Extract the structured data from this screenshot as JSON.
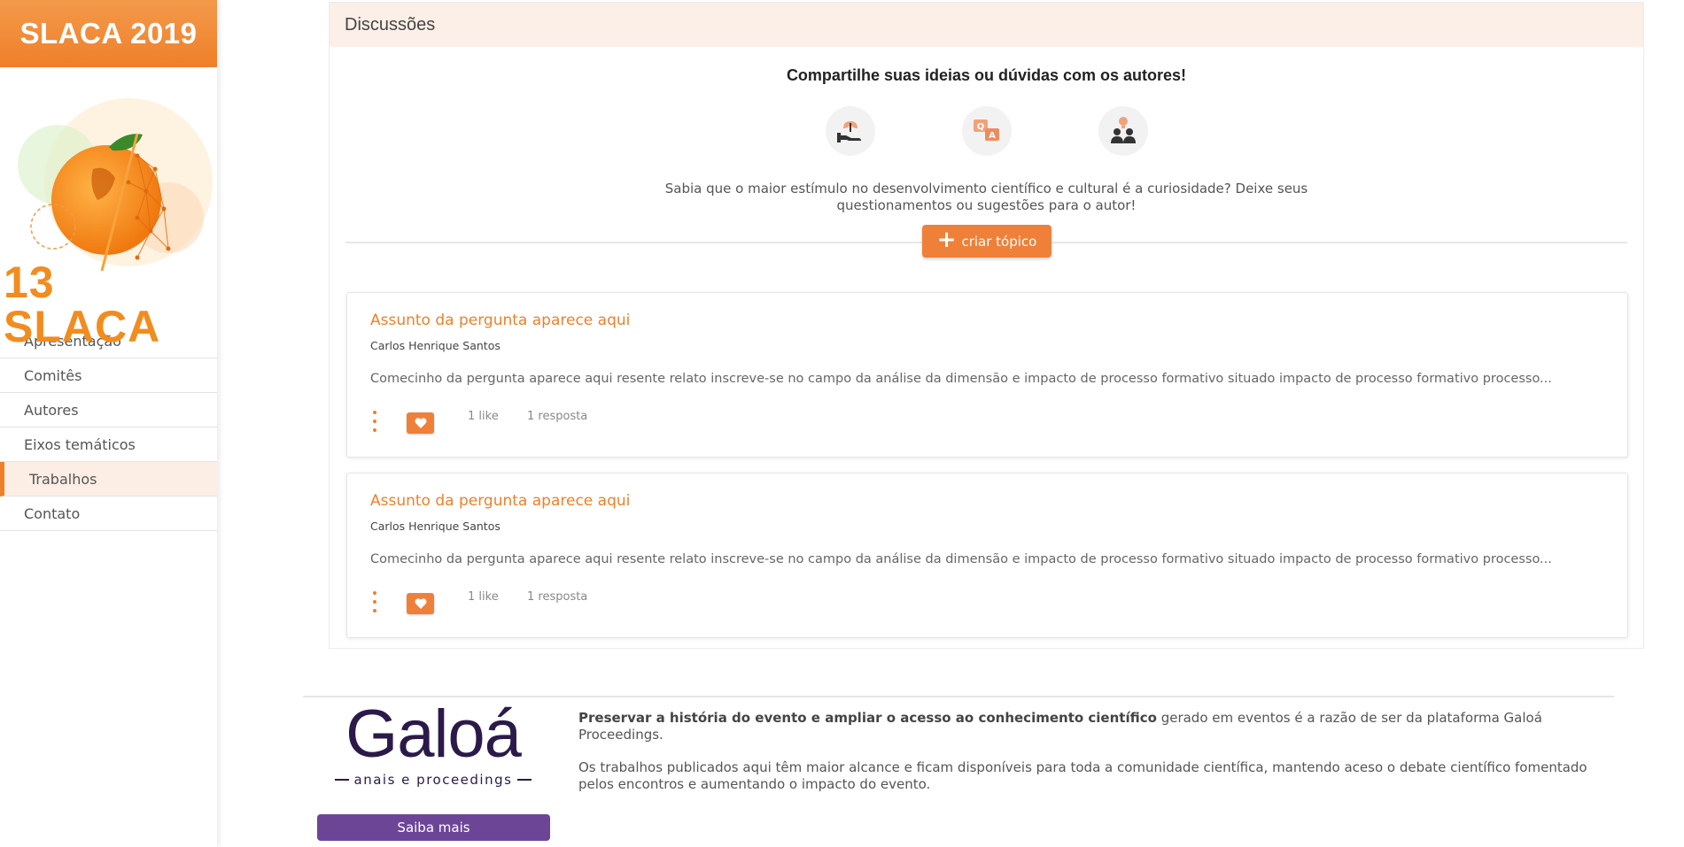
{
  "sidebar": {
    "brand": "SLACA 2019",
    "logo_text": "13 SLACA",
    "nav": [
      {
        "label": "Apresentação"
      },
      {
        "label": "Comitês"
      },
      {
        "label": "Autores"
      },
      {
        "label": "Eixos temáticos"
      },
      {
        "label": "Trabalhos",
        "active": true
      },
      {
        "label": "Contato"
      }
    ]
  },
  "discussions": {
    "header": "Discussões",
    "intro_title": "Compartilhe suas ideias ou dúvidas com os autores!",
    "icons": [
      "hand-plant-icon",
      "q-and-a-icon",
      "people-idea-icon"
    ],
    "intro_text": "Sabia que o maior estímulo no desenvolvimento científico e cultural é a curiosidade? Deixe seus questionamentos ou sugestões para o autor!",
    "create_button": "criar tópico",
    "topics": [
      {
        "title": "Assunto da pergunta aparece aqui",
        "author": "Carlos Henrique Santos",
        "body": "Comecinho da pergunta aparece aqui resente relato inscreve-se no campo da análise da dimensão e impacto de processo formativo situado impacto de processo formativo processo...",
        "likes": "1 like",
        "replies": "1 resposta"
      },
      {
        "title": "Assunto da pergunta aparece aqui",
        "author": "Carlos Henrique Santos",
        "body": "Comecinho da pergunta aparece aqui resente relato inscreve-se no campo da análise da dimensão e impacto de processo formativo situado impacto de processo formativo processo...",
        "likes": "1 like",
        "replies": "1 resposta"
      }
    ]
  },
  "footer": {
    "logo_word": "Galoá",
    "logo_sub": "anais e proceedings",
    "button": "Saiba mais",
    "p1_bold": "Preservar a história do evento e ampliar o acesso ao conhecimento científico",
    "p1_rest": " gerado em eventos é a razão de ser da plataforma Galoá Proceedings.",
    "p2": "Os trabalhos publicados aqui têm maior alcance e ficam disponíveis para toda a comunidade científica, mantendo aceso o debate científico fomentado pelos encontros e aumentando o impacto do evento."
  },
  "colors": {
    "accent": "#ef7f2a",
    "galoa_purple": "#6c4597",
    "header_tint": "#fcefe8"
  }
}
